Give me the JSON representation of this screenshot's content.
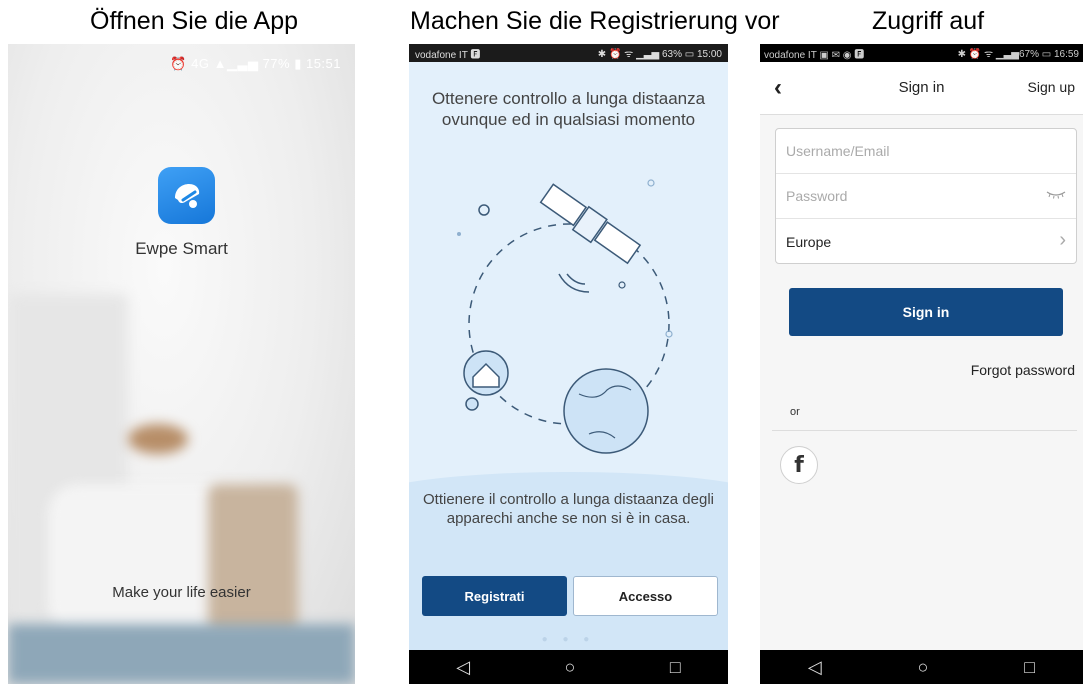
{
  "captions": [
    "Öffnen Sie die App",
    "Machen Sie die Registrierung vor",
    "Zugriff auf"
  ],
  "splash": {
    "status": "⏰ 4G ▲▁▃▅ 77% ▮ 15:51",
    "app_name": "Ewpe Smart",
    "tagline": "Make your life easier",
    "logo_color": "#1e88e5"
  },
  "intro": {
    "status_left": "vodafone IT 🅵",
    "status_right": "✱ ⏰ ᯤ ▁▃▅ 63% ▭ 15:00",
    "headline": "Ottenere controllo a lunga distaanza ovunque ed in qualsiasi momento",
    "description": "Ottienere il controllo a lunga distaanza degli apparechi anche se non si è in casa.",
    "register_label": "Registrati",
    "access_label": "Accesso",
    "accent": "#134a84"
  },
  "signin": {
    "status_left": "vodafone IT ▣ ✉ ◉ 🅵",
    "status_right": "✱ ⏰ ᯤ ▁▃▅67% ▭ 16:59",
    "title": "Sign in",
    "signup_label": "Sign up",
    "username_placeholder": "Username/Email",
    "password_placeholder": "Password",
    "region": "Europe",
    "signin_button": "Sign in",
    "forgot_label": "Forgot password",
    "or_label": "or",
    "facebook": "f"
  },
  "nav": {
    "back": "◁",
    "home": "○",
    "recent": "□"
  }
}
